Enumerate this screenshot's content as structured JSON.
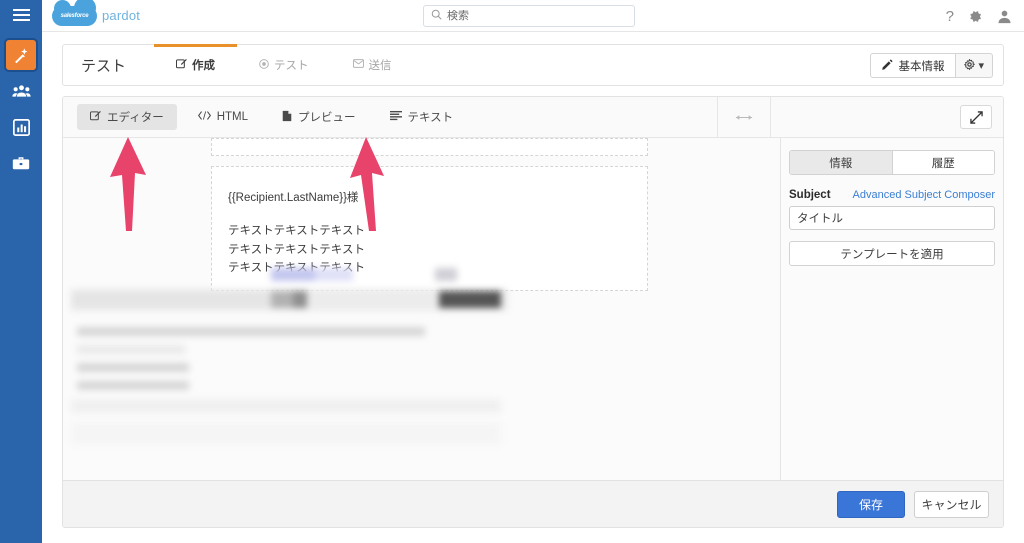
{
  "app": {
    "brand_name": "salesforce",
    "product_name": "pardot",
    "sidebar_accent": "#ef8233",
    "sidebar_bg": "#2a64ab",
    "annotation_color": "#e8436a"
  },
  "topbar": {
    "menu_icon": "hamburger-menu-icon",
    "search": {
      "placeholder": "検索",
      "value": "",
      "icon": "search-icon"
    },
    "help_icon": "question-mark-icon",
    "settings_icon": "gear-icon",
    "user_icon": "user-avatar-icon"
  },
  "sidebar": {
    "items": [
      {
        "label": "マーケティング",
        "icon": "magic-wand-icon",
        "active": true
      },
      {
        "label": "プロスペクト",
        "icon": "people-group-icon",
        "active": false
      },
      {
        "label": "レポート",
        "icon": "bar-chart-icon",
        "active": false
      },
      {
        "label": "管理",
        "icon": "briefcase-icon",
        "active": false
      }
    ]
  },
  "page_header": {
    "title": "テスト",
    "tabs": [
      {
        "label": "作成",
        "icon": "edit-pencil-icon",
        "active": true
      },
      {
        "label": "テスト",
        "icon": "target-icon",
        "active": false
      },
      {
        "label": "送信",
        "icon": "envelope-icon",
        "active": false
      }
    ],
    "basic_info_button": {
      "label": "基本情報",
      "icon": "pencil-icon"
    },
    "gear_button": {
      "icon": "gear-icon",
      "caret": "▾"
    }
  },
  "editor": {
    "tabs": [
      {
        "label": "エディター",
        "icon": "editor-pencil-icon",
        "active": true
      },
      {
        "label": "HTML",
        "icon": "code-brackets-icon",
        "active": false
      },
      {
        "label": "プレビュー",
        "icon": "document-icon",
        "active": false
      },
      {
        "label": "テキスト",
        "icon": "text-lines-icon",
        "active": false
      }
    ],
    "resize_handle_icon": "horizontal-resize-icon",
    "expand_button_icon": "expand-diagonal-icon"
  },
  "email_content": {
    "greeting": "{{Recipient.LastName}}様",
    "body_lines": [
      "テキストテキストテキスト",
      "テキストテキストテキスト",
      "テキストテキストテキスト"
    ]
  },
  "side_panel": {
    "segments": [
      {
        "label": "情報",
        "active": true
      },
      {
        "label": "履歴",
        "active": false
      }
    ],
    "subject_label": "Subject",
    "advanced_link": "Advanced Subject Composer",
    "subject_value": "タイトル",
    "subject_placeholder": "",
    "template_button": "テンプレートを適用"
  },
  "footer": {
    "save_label": "保存",
    "cancel_label": "キャンセル"
  },
  "annotations": [
    {
      "name": "arrow-pointing-editor-tab",
      "target": "エディター"
    },
    {
      "name": "arrow-pointing-text-tab",
      "target": "テキスト"
    }
  ]
}
